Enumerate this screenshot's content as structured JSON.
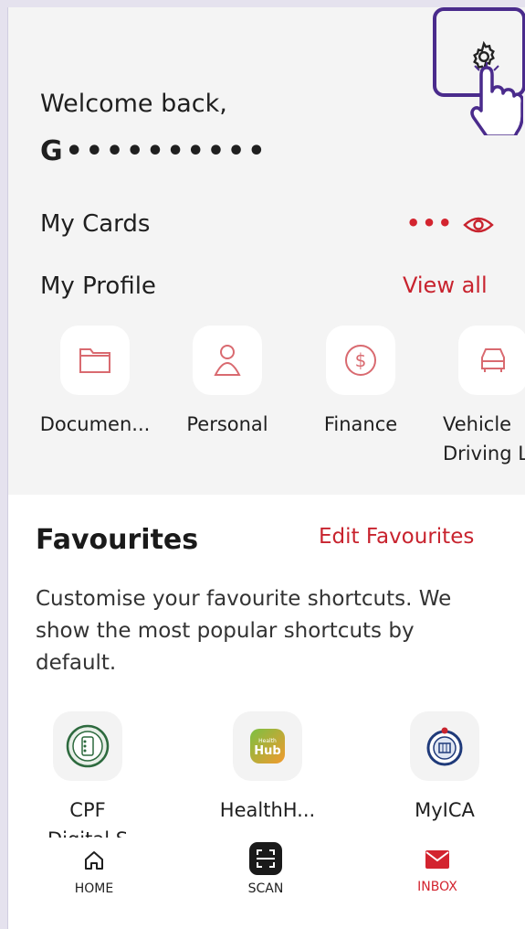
{
  "header": {
    "welcome": "Welcome back,",
    "username": "G••••••••••"
  },
  "cards": {
    "title": "My Cards",
    "more": "•••"
  },
  "profile": {
    "title": "My Profile",
    "view_all": "View all",
    "items": [
      {
        "label": "Documen...",
        "icon": "folder-icon"
      },
      {
        "label": "Personal",
        "icon": "person-icon"
      },
      {
        "label": "Finance",
        "icon": "dollar-icon"
      },
      {
        "label": "Vehicle\nDriving Li",
        "icon": "car-icon"
      }
    ]
  },
  "favourites": {
    "title": "Favourites",
    "edit": "Edit Favourites",
    "description": "Customise your favourite shortcuts. We show the most popular shortcuts by default.",
    "items": [
      {
        "label": "CPF\nDigital S",
        "icon": "cpf-logo-icon"
      },
      {
        "label": "HealthH...",
        "icon": "healthhub-logo-icon"
      },
      {
        "label": "MyICA",
        "icon": "ica-logo-icon"
      }
    ]
  },
  "nav": {
    "home": "HOME",
    "scan": "SCAN",
    "inbox": "INBOX"
  },
  "colors": {
    "accent": "#c8232e",
    "highlight": "#4a2b8c"
  }
}
